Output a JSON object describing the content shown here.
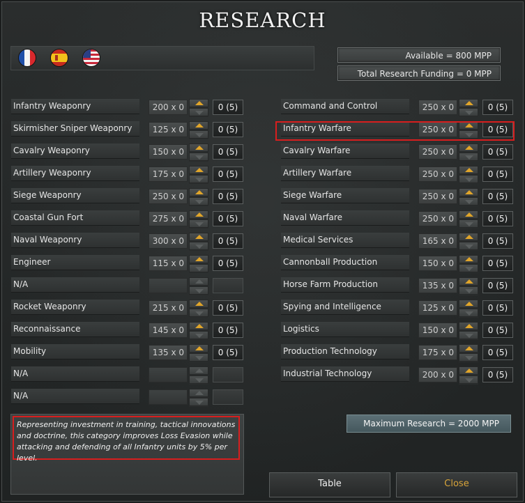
{
  "title": "RESEARCH",
  "flags": [
    {
      "name": "france-flag-icon"
    },
    {
      "name": "spain-flag-icon"
    },
    {
      "name": "usa-flag-icon"
    }
  ],
  "available": "Available =  800 MPP",
  "total_funding": "Total Research Funding = 0 MPP",
  "left_rows": [
    {
      "label": "Infantry Weaponry",
      "cost": "200 x 0",
      "level": "0 (5)",
      "enabled": true
    },
    {
      "label": "Skirmisher Sniper Weaponry",
      "cost": "125 x 0",
      "level": "0 (5)",
      "enabled": true
    },
    {
      "label": "Cavalry Weaponry",
      "cost": "150 x 0",
      "level": "0 (5)",
      "enabled": true
    },
    {
      "label": "Artillery Weaponry",
      "cost": "175 x 0",
      "level": "0 (5)",
      "enabled": true
    },
    {
      "label": "Siege Weaponry",
      "cost": "250 x 0",
      "level": "0 (5)",
      "enabled": true
    },
    {
      "label": "Coastal Gun Fort",
      "cost": "275 x 0",
      "level": "0 (5)",
      "enabled": true
    },
    {
      "label": "Naval Weaponry",
      "cost": "300 x 0",
      "level": "0 (5)",
      "enabled": true
    },
    {
      "label": "Engineer",
      "cost": "115 x 0",
      "level": "0 (5)",
      "enabled": true
    },
    {
      "label": "N/A",
      "cost": "",
      "level": "",
      "enabled": false
    },
    {
      "label": "Rocket Weaponry",
      "cost": "215 x 0",
      "level": "0 (5)",
      "enabled": true
    },
    {
      "label": "Reconnaissance",
      "cost": "145 x 0",
      "level": "0 (5)",
      "enabled": true
    },
    {
      "label": "Mobility",
      "cost": "135 x 0",
      "level": "0 (5)",
      "enabled": true
    },
    {
      "label": "N/A",
      "cost": "",
      "level": "",
      "enabled": false
    },
    {
      "label": "N/A",
      "cost": "",
      "level": "",
      "enabled": false
    }
  ],
  "right_rows": [
    {
      "label": "Command and Control",
      "cost": "250 x 0",
      "level": "0 (5)",
      "enabled": true
    },
    {
      "label": "Infantry Warfare",
      "cost": "250 x 0",
      "level": "0 (5)",
      "enabled": true
    },
    {
      "label": "Cavalry Warfare",
      "cost": "250 x 0",
      "level": "0 (5)",
      "enabled": true
    },
    {
      "label": "Artillery Warfare",
      "cost": "250 x 0",
      "level": "0 (5)",
      "enabled": true
    },
    {
      "label": "Siege Warfare",
      "cost": "250 x 0",
      "level": "0 (5)",
      "enabled": true
    },
    {
      "label": "Naval Warfare",
      "cost": "250 x 0",
      "level": "0 (5)",
      "enabled": true
    },
    {
      "label": "Medical Services",
      "cost": "165 x 0",
      "level": "0 (5)",
      "enabled": true
    },
    {
      "label": "Cannonball Production",
      "cost": "150 x 0",
      "level": "0 (5)",
      "enabled": true
    },
    {
      "label": "Horse Farm Production",
      "cost": "135 x 0",
      "level": "0 (5)",
      "enabled": true
    },
    {
      "label": "Spying and Intelligence",
      "cost": "125 x 0",
      "level": "0 (5)",
      "enabled": true
    },
    {
      "label": "Logistics",
      "cost": "150 x 0",
      "level": "0 (5)",
      "enabled": true
    },
    {
      "label": "Production Technology",
      "cost": "175 x 0",
      "level": "0 (5)",
      "enabled": true
    },
    {
      "label": "Industrial Technology",
      "cost": "200 x 0",
      "level": "0 (5)",
      "enabled": true
    }
  ],
  "description": "Representing investment in training, tactical innovations and doctrine, this category improves Loss Evasion while attacking and defending of all Infantry units by 5% per level.",
  "max_research": "Maximum Research =  2000 MPP",
  "buttons": {
    "table": "Table",
    "close": "Close"
  },
  "colors": {
    "accent_arrow": "#e0a52a",
    "close_text": "#d9a53a",
    "highlight": "#d81e1e"
  }
}
